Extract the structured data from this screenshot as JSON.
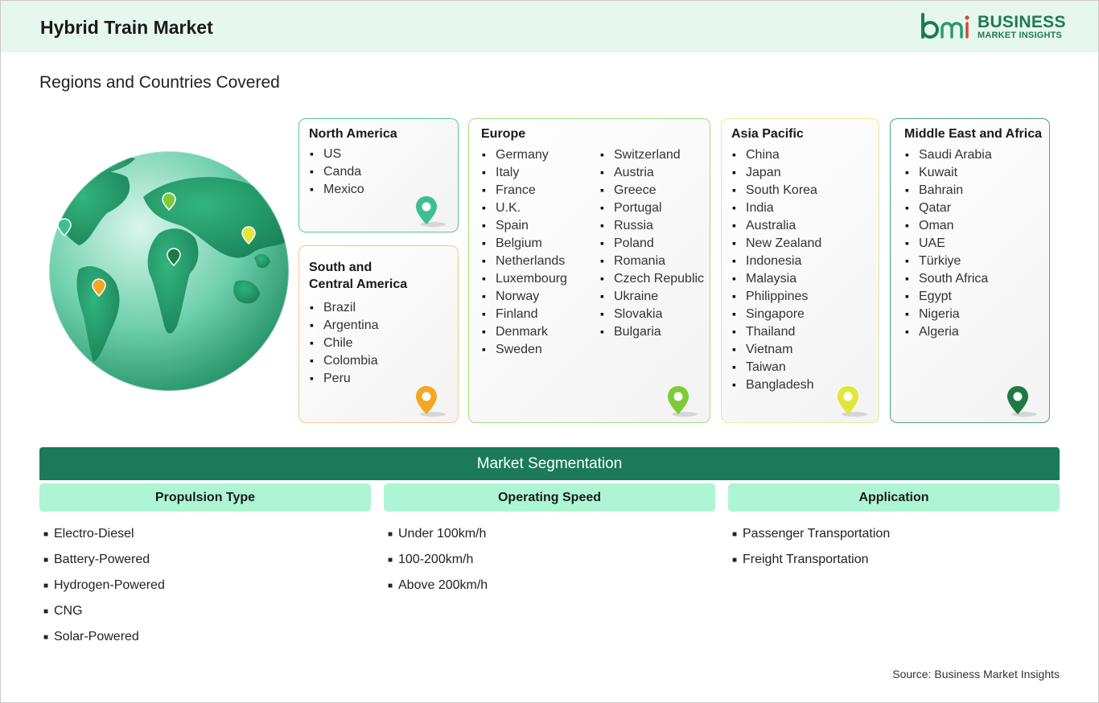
{
  "header": {
    "title": "Hybrid Train Market",
    "logo_line1": "BUSINESS",
    "logo_line2": "MARKET INSIGHTS",
    "logo_mark": "bmi"
  },
  "section_title": "Regions and Countries Covered",
  "regions": [
    {
      "name": "North America",
      "color": "#3fbf8f",
      "countries": [
        "US",
        "Canda",
        "Mexico"
      ]
    },
    {
      "name": "South and Central America",
      "name_line1": "South and",
      "name_line2": "Central America",
      "color": "#f5a623",
      "countries": [
        "Brazil",
        "Argentina",
        "Chile",
        "Colombia",
        "Peru"
      ]
    },
    {
      "name": "Europe",
      "color": "#7ecb3a",
      "countries_col1": [
        "Germany",
        "Italy",
        "France",
        "U.K.",
        "Spain",
        "Belgium",
        "Netherlands",
        "Luxembourg",
        "Norway",
        "Finland",
        "Denmark",
        "Sweden"
      ],
      "countries_col2": [
        "Switzerland",
        "Austria",
        "Greece",
        "Portugal",
        "Russia",
        "Poland",
        "Romania",
        "Czech Republic",
        "Ukraine",
        "Slovakia",
        "Bulgaria"
      ]
    },
    {
      "name": "Asia Pacific",
      "color": "#e3e63a",
      "countries": [
        "China",
        "Japan",
        "South Korea",
        "India",
        "Australia",
        "New Zealand",
        "Indonesia",
        "Malaysia",
        "Philippines",
        "Singapore",
        "Thailand",
        "Vietnam",
        "Taiwan",
        "Bangladesh"
      ]
    },
    {
      "name": "Middle East and Africa",
      "color": "#1e7a45",
      "countries": [
        "Saudi Arabia",
        "Kuwait",
        "Bahrain",
        "Qatar",
        "Oman",
        "UAE",
        "Türkiye",
        "South Africa",
        "Egypt",
        "Nigeria",
        "Algeria"
      ]
    }
  ],
  "segmentation": {
    "title": "Market Segmentation",
    "columns": [
      {
        "heading": "Propulsion Type",
        "items": [
          "Electro-Diesel",
          "Battery-Powered",
          "Hydrogen-Powered",
          "CNG",
          "Solar-Powered"
        ]
      },
      {
        "heading": "Operating Speed",
        "items": [
          "Under 100km/h",
          "100-200km/h",
          "Above 200km/h"
        ]
      },
      {
        "heading": "Application",
        "items": [
          "Passenger Transportation",
          "Freight Transportation"
        ]
      }
    ]
  },
  "source": "Source: Business Market Insights",
  "icons": {
    "globe": "globe-icon",
    "pin": "map-pin-icon"
  }
}
